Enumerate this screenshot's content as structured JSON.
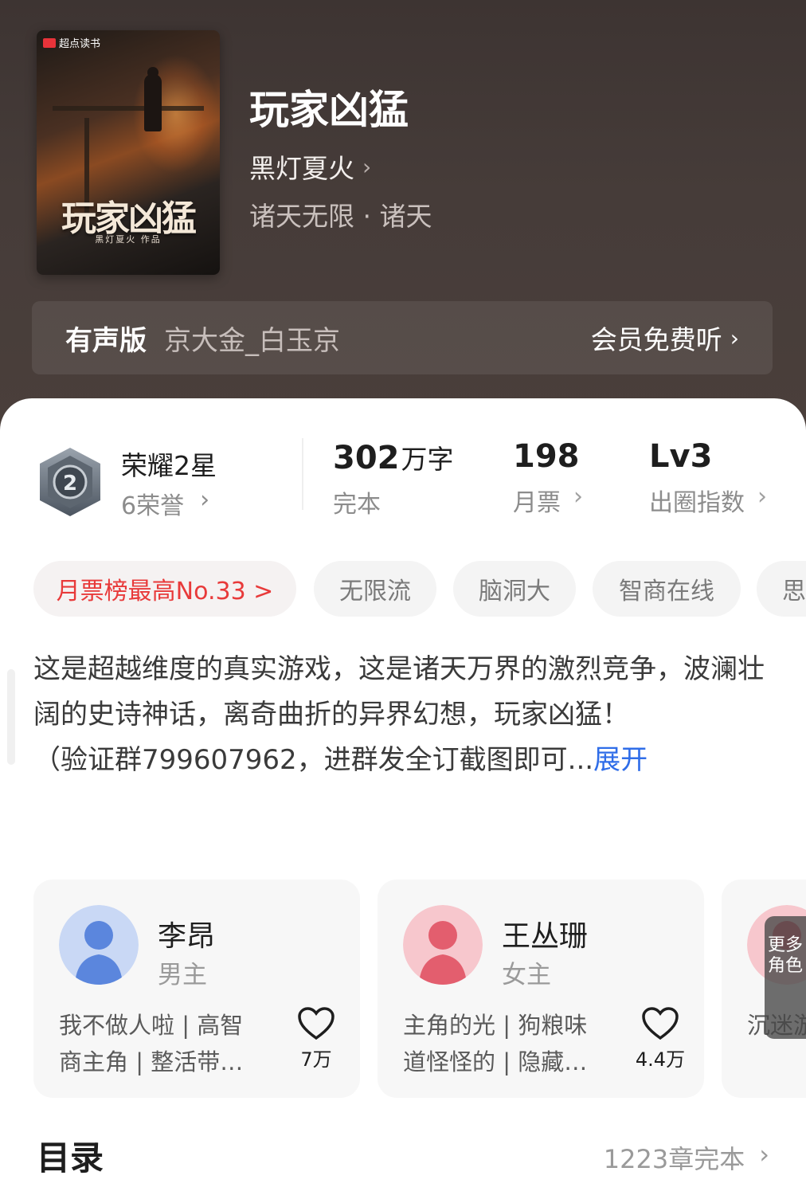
{
  "book": {
    "cover_publisher": "超点读书",
    "cover_title": "玩家凶猛",
    "cover_author": "黑灯夏火  作品",
    "title": "玩家凶猛",
    "author": "黑灯夏火",
    "genre": "诸天无限 · 诸天"
  },
  "audio": {
    "label": "有声版",
    "narrator": "京大金_白玉京",
    "action": "会员免费听"
  },
  "stats": {
    "honor_name": "荣耀2星",
    "honor_badge_number": "2",
    "honor_sub": "6荣誉",
    "words_num": "302",
    "words_unit": "万字",
    "words_label": "完本",
    "votes_num": "198",
    "votes_label": "月票",
    "level_num": "Lv3",
    "level_label": "出圈指数"
  },
  "tags": [
    "月票榜最高No.33 >",
    "无限流",
    "脑洞大",
    "智商在线",
    "思"
  ],
  "description": {
    "text": "这是超越维度的真实游戏，这是诸天万界的激烈竞争，波澜壮阔的史诗神话，离奇曲折的异界幻想，玩家凶猛！\n（验证群799607962，进群发全订截图即可...",
    "expand": "展开"
  },
  "characters": [
    {
      "name": "李昂",
      "role": "男主",
      "tags": "我不做人啦 | 高智商主角 | 整活带…",
      "likes": "7万"
    },
    {
      "name": "王丛珊",
      "role": "女主",
      "tags": "主角的光 | 狗粮味道怪怪的 | 隐藏…",
      "likes": "4.4万"
    },
    {
      "name": "",
      "role": "",
      "tags": "沉迷游戏 主角",
      "likes": ""
    }
  ],
  "more_characters": "更多角色",
  "toc": {
    "title": "目录",
    "info": "1223章完本"
  },
  "colors": {
    "header_bg": "#3d3432",
    "rank_tag": "#e83a3a",
    "expand_link": "#2f6de8"
  }
}
